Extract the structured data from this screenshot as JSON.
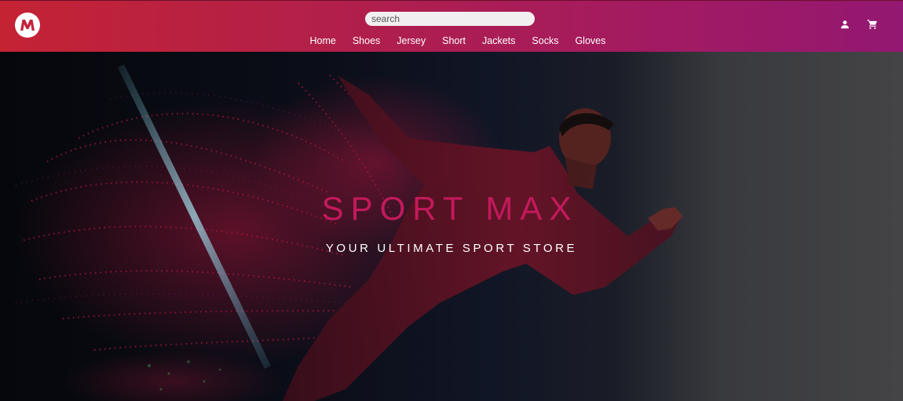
{
  "header": {
    "logo_icon": "brand-logo-icon",
    "search": {
      "placeholder": "search",
      "value": ""
    },
    "nav": [
      "Home",
      "Shoes",
      "Jersey",
      "Short",
      "Jackets",
      "Socks",
      "Gloves"
    ],
    "icons": {
      "account": "user-icon",
      "cart": "cart-icon"
    }
  },
  "hero": {
    "title": "SPORT MAX",
    "subtitle": "YOUR ULTIMATE SPORT STORE"
  },
  "colors": {
    "header_gradient_start": "#c42334",
    "header_gradient_end": "#931871",
    "accent": "#c4195c"
  }
}
